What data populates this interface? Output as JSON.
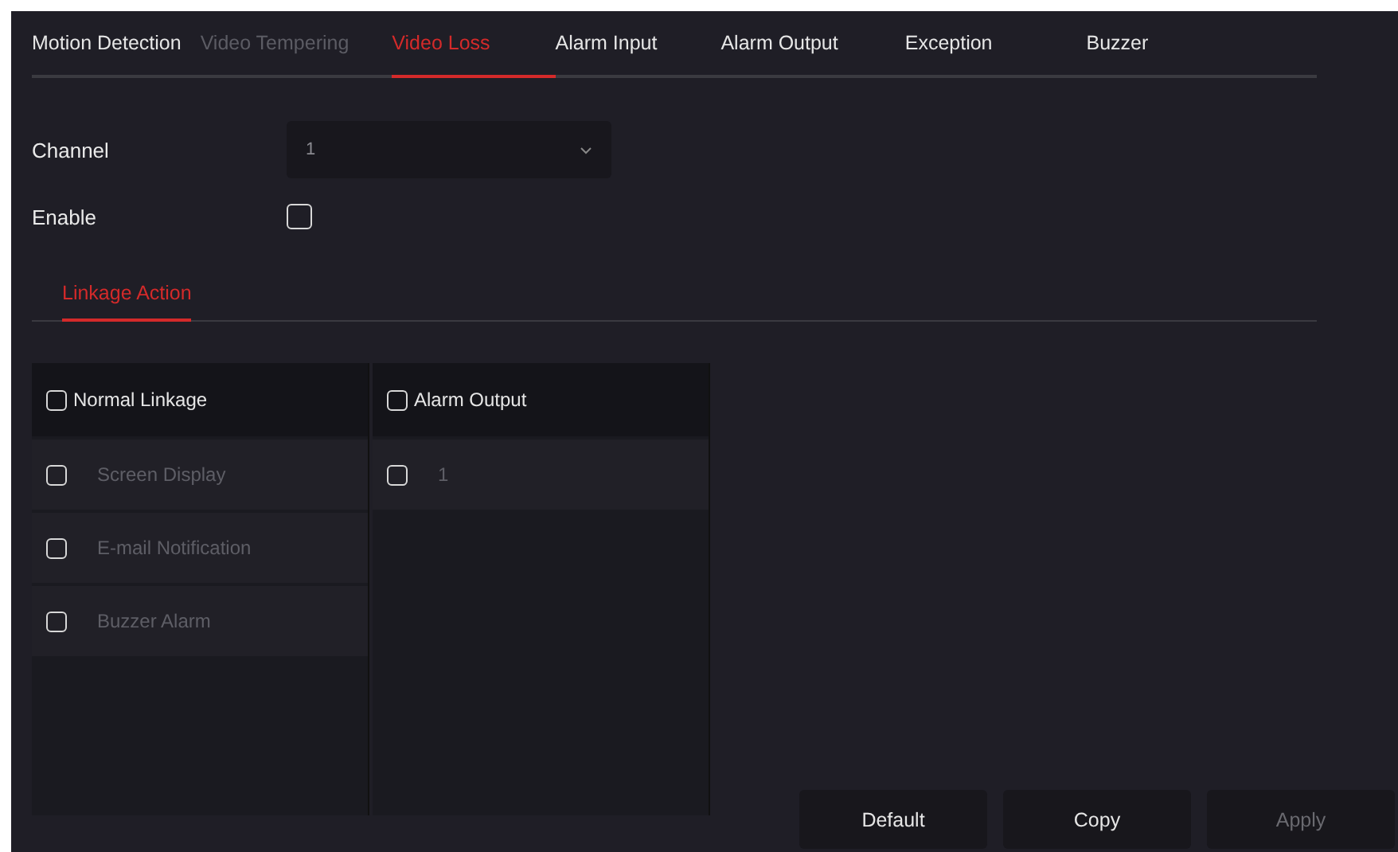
{
  "tabs": [
    {
      "label": "Motion Detection",
      "selected": false,
      "disabled": false
    },
    {
      "label": "Video Tempering",
      "selected": false,
      "disabled": true
    },
    {
      "label": "Video Loss",
      "selected": true,
      "disabled": false
    },
    {
      "label": "Alarm Input",
      "selected": false,
      "disabled": false
    },
    {
      "label": "Alarm Output",
      "selected": false,
      "disabled": false
    },
    {
      "label": "Exception",
      "selected": false,
      "disabled": false
    },
    {
      "label": "Buzzer",
      "selected": false,
      "disabled": false
    }
  ],
  "channel": {
    "label": "Channel",
    "value": "1"
  },
  "enable": {
    "label": "Enable",
    "checked": false
  },
  "sub_tabs": [
    {
      "label": "Linkage Action",
      "selected": true
    }
  ],
  "linkage_columns": [
    {
      "title": "Normal Linkage",
      "checked": false,
      "items": [
        {
          "label": "Screen Display",
          "checked": false,
          "disabled": true
        },
        {
          "label": "E-mail Notification",
          "checked": false,
          "disabled": true
        },
        {
          "label": "Buzzer Alarm",
          "checked": false,
          "disabled": true
        }
      ]
    },
    {
      "title": "Alarm Output",
      "checked": false,
      "items": [
        {
          "label": "1",
          "checked": false,
          "disabled": true
        }
      ]
    }
  ],
  "buttons": [
    {
      "label": "Default",
      "disabled": false
    },
    {
      "label": "Copy",
      "disabled": false
    },
    {
      "label": "Apply",
      "disabled": true
    }
  ]
}
